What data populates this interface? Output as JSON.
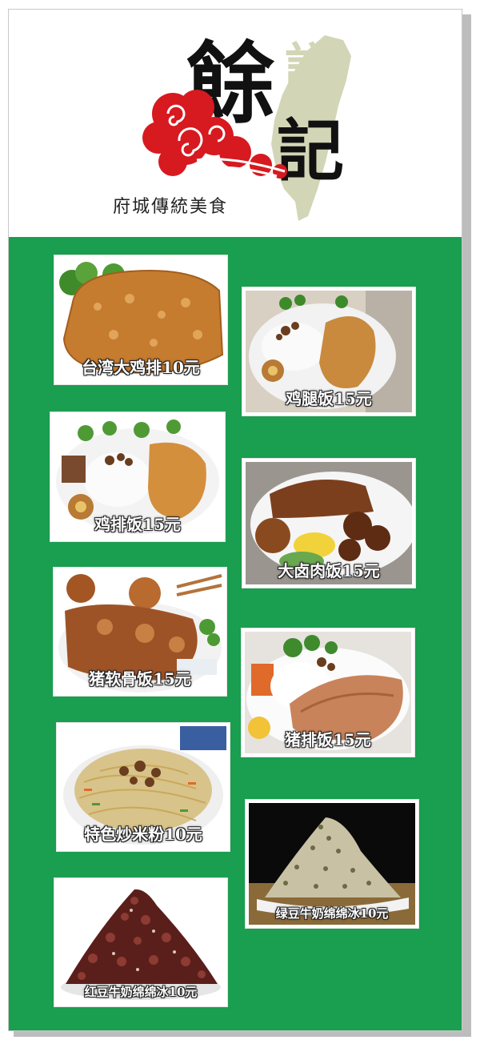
{
  "brand": {
    "name_char1": "餘",
    "name_char2": "記",
    "ghost_char": "詳",
    "slogan": "府城傳統美食",
    "colors": {
      "cloud": "#d71920",
      "map": "#d2d6b6",
      "background": "#1a9e4f"
    }
  },
  "menu": [
    {
      "label": "台湾大鸡排10元",
      "food": "fried-chicken-cutlet"
    },
    {
      "label": "鸡腿饭15元",
      "food": "chicken-leg-rice"
    },
    {
      "label": "鸡排饭15元",
      "food": "chicken-cutlet-rice"
    },
    {
      "label": "大卤肉饭15元",
      "food": "braised-pork-rice"
    },
    {
      "label": "猪软骨饭15元",
      "food": "pork-cartilage-rice"
    },
    {
      "label": "猪排饭15元",
      "food": "pork-chop-rice"
    },
    {
      "label": "特色炒米粉10元",
      "food": "fried-rice-noodles"
    },
    {
      "label": "绿豆牛奶绵绵冰10元",
      "food": "mung-bean-milk-ice"
    },
    {
      "label": "红豆牛奶绵绵冰10元",
      "food": "red-bean-milk-ice"
    }
  ]
}
